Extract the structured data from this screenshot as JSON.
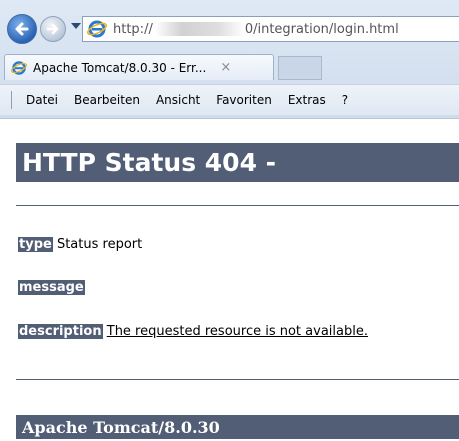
{
  "browser": {
    "url_prefix": "http://",
    "url_suffix": "0/integration/login.html",
    "tab_title": "Apache Tomcat/8.0.30 - Err...",
    "tab_close": "×",
    "menu": [
      "Datei",
      "Bearbeiten",
      "Ansicht",
      "Favoriten",
      "Extras",
      "?"
    ]
  },
  "page": {
    "heading": "HTTP Status 404 -",
    "type_label": "type",
    "type_value": "Status report",
    "message_label": "message",
    "description_label": "description",
    "description_value": "The requested resource is not available.",
    "footer": "Apache Tomcat/8.0.30"
  },
  "colors": {
    "tomcat_bar": "#525d76",
    "chrome_bg": "#dfe9f5"
  }
}
